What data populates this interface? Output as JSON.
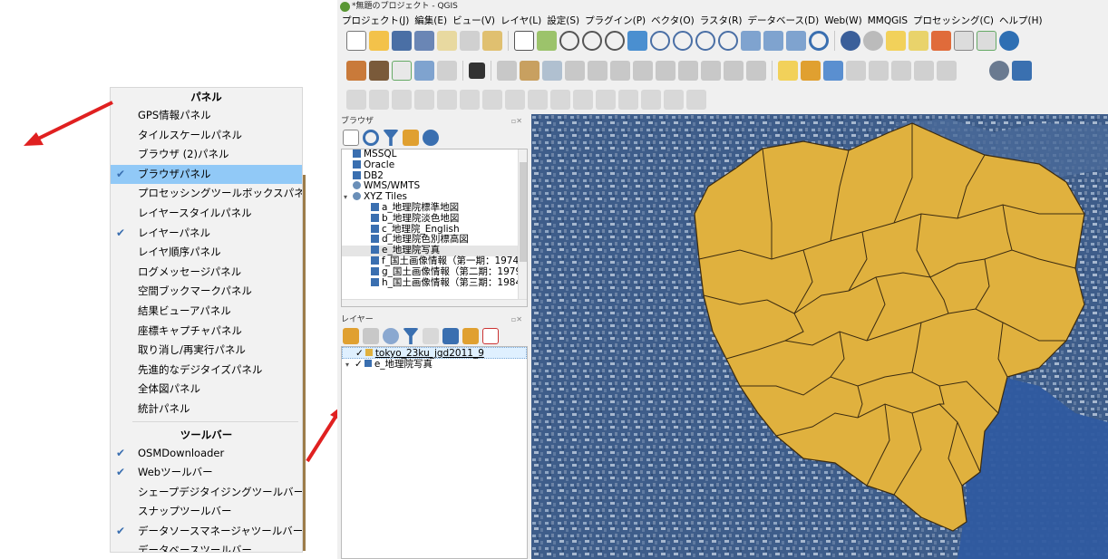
{
  "context_menu": {
    "panels_header": "パネル",
    "panel_items": [
      {
        "label": "GPS情報パネル",
        "checked": false,
        "highlighted": false
      },
      {
        "label": "タイルスケールパネル",
        "checked": false,
        "highlighted": false
      },
      {
        "label": "ブラウザ (2)パネル",
        "checked": false,
        "highlighted": false
      },
      {
        "label": "ブラウザパネル",
        "checked": true,
        "highlighted": true
      },
      {
        "label": "プロセッシングツールボックスパネル",
        "checked": false,
        "highlighted": false
      },
      {
        "label": "レイヤースタイルパネル",
        "checked": false,
        "highlighted": false
      },
      {
        "label": "レイヤーパネル",
        "checked": true,
        "highlighted": false
      },
      {
        "label": "レイヤ順序パネル",
        "checked": false,
        "highlighted": false
      },
      {
        "label": "ログメッセージパネル",
        "checked": false,
        "highlighted": false
      },
      {
        "label": "空間ブックマークパネル",
        "checked": false,
        "highlighted": false
      },
      {
        "label": "結果ビューアパネル",
        "checked": false,
        "highlighted": false
      },
      {
        "label": "座標キャプチャパネル",
        "checked": false,
        "highlighted": false
      },
      {
        "label": "取り消し/再実行パネル",
        "checked": false,
        "highlighted": false
      },
      {
        "label": "先進的なデジタイズパネル",
        "checked": false,
        "highlighted": false
      },
      {
        "label": "全体図パネル",
        "checked": false,
        "highlighted": false
      },
      {
        "label": "統計パネル",
        "checked": false,
        "highlighted": false
      }
    ],
    "toolbars_header": "ツールバー",
    "toolbar_items": [
      {
        "label": "OSMDownloader",
        "checked": true
      },
      {
        "label": "Webツールバー",
        "checked": true
      },
      {
        "label": "シェープデジタイジングツールバー",
        "checked": false
      },
      {
        "label": "スナップツールバー",
        "checked": false
      },
      {
        "label": "データソースマネージャツールバー",
        "checked": true
      },
      {
        "label": "データベースツールバー",
        "checked": false
      }
    ],
    "checkmark": "✔",
    "highlight_color": "#91c9f7"
  },
  "window": {
    "title": "*無題のプロジェクト - QGIS"
  },
  "menubar": [
    "プロジェクト(J)",
    "編集(E)",
    "ビュー(V)",
    "レイヤ(L)",
    "設定(S)",
    "プラグイン(P)",
    "ベクタ(O)",
    "ラスタ(R)",
    "データベース(D)",
    "Web(W)",
    "MMQGIS",
    "プロセッシング(C)",
    "ヘルプ(H)"
  ],
  "browser": {
    "title": "ブラウザ",
    "items": [
      {
        "label": "MSSQL",
        "icon": "mssql-icon",
        "indent": false,
        "expand": "",
        "selected": false
      },
      {
        "label": "Oracle",
        "icon": "oracle-icon",
        "indent": false,
        "expand": "",
        "selected": false
      },
      {
        "label": "DB2",
        "icon": "db2-icon",
        "indent": false,
        "expand": "",
        "selected": false
      },
      {
        "label": "WMS/WMTS",
        "icon": "wms-icon",
        "indent": false,
        "expand": "",
        "selected": false
      },
      {
        "label": "XYZ Tiles",
        "icon": "xyz-icon",
        "indent": false,
        "expand": "▾",
        "selected": false
      },
      {
        "label": "a_地理院標準地図",
        "icon": "tile-icon",
        "indent": true,
        "expand": "",
        "selected": false
      },
      {
        "label": "b_地理院淡色地図",
        "icon": "tile-icon",
        "indent": true,
        "expand": "",
        "selected": false
      },
      {
        "label": "c_地理院_English",
        "icon": "tile-icon",
        "indent": true,
        "expand": "",
        "selected": false
      },
      {
        "label": "d_地理院色別標高図",
        "icon": "tile-icon",
        "indent": true,
        "expand": "",
        "selected": false
      },
      {
        "label": "e_地理院写真",
        "icon": "tile-icon",
        "indent": true,
        "expand": "",
        "selected": true
      },
      {
        "label": "f_国土画像情報（第一期：1974-",
        "icon": "tile-icon",
        "indent": true,
        "expand": "",
        "selected": false
      },
      {
        "label": "g_国土画像情報（第二期：1979",
        "icon": "tile-icon",
        "indent": true,
        "expand": "",
        "selected": false
      },
      {
        "label": "h_国土画像情報（第三期：1984",
        "icon": "tile-icon",
        "indent": true,
        "expand": "",
        "selected": false
      }
    ]
  },
  "layers": {
    "title": "レイヤー",
    "items": [
      {
        "label": "tokyo_23ku_jgd2011_9",
        "checked": true,
        "icon": "polygon-layer-icon",
        "selected": true,
        "expand": ""
      },
      {
        "label": "e_地理院写真",
        "checked": true,
        "icon": "raster-layer-icon",
        "selected": false,
        "expand": "▾"
      }
    ]
  },
  "map": {
    "polygon_fill": "#e0b13e",
    "polygon_stroke": "#3a2a10",
    "water_color": "#2f5aa0",
    "land_color": "#3c5a86"
  },
  "arrows": {
    "color": "#e02020"
  }
}
